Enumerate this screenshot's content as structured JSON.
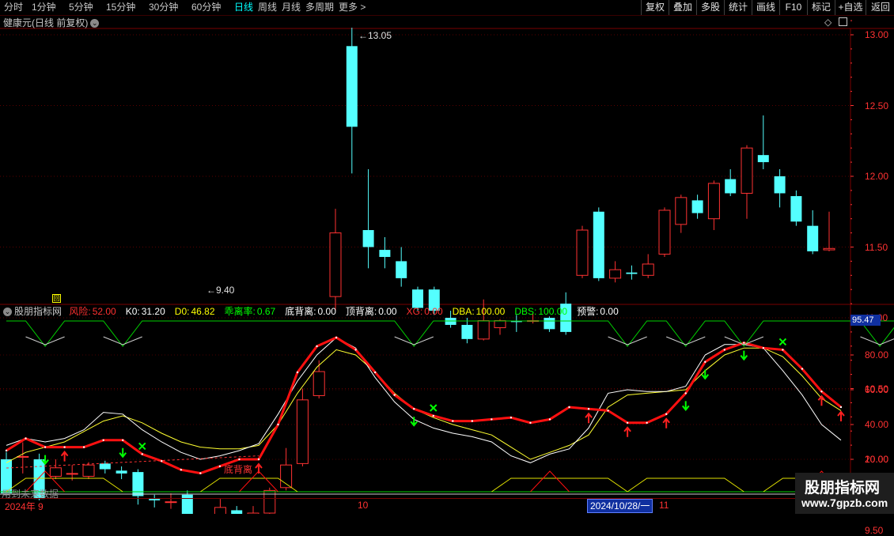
{
  "toolbar": {
    "periods": [
      "分时",
      "1分钟",
      "5分钟",
      "15分钟",
      "30分钟",
      "60分钟",
      "日线",
      "周线",
      "月线",
      "多周期",
      "更多 >"
    ],
    "active_period": "日线",
    "right_buttons": [
      "复权",
      "叠加",
      "多股",
      "统计",
      "画线",
      "F10",
      "标记",
      "+自选",
      "返回"
    ]
  },
  "main_chart": {
    "title": "健康元(日线 前复权)",
    "title_icon": "chevron-down-icon",
    "corner_icons": [
      "diamond-icon",
      "close-square-icon"
    ],
    "price_axis": [
      "13.00",
      "12.50",
      "12.00",
      "11.50",
      "11.00",
      "10.50",
      "10.00",
      "9.50"
    ],
    "high_label": "13.05",
    "low_label": "9.40",
    "candles": [
      {
        "o": 10.0,
        "c": 9.76,
        "h": 10.05,
        "l": 9.74
      },
      {
        "o": 10.02,
        "c": 10.02,
        "h": 10.12,
        "l": 9.9
      },
      {
        "o": 10.0,
        "c": 9.72,
        "h": 10.04,
        "l": 9.71
      },
      {
        "o": 9.88,
        "c": 9.94,
        "h": 10.0,
        "l": 9.86
      },
      {
        "o": 9.9,
        "c": 9.9,
        "h": 9.96,
        "l": 9.85
      },
      {
        "o": 9.88,
        "c": 9.96,
        "h": 9.98,
        "l": 9.86
      },
      {
        "o": 9.97,
        "c": 9.93,
        "h": 9.99,
        "l": 9.9
      },
      {
        "o": 9.92,
        "c": 9.9,
        "h": 9.95,
        "l": 9.86
      },
      {
        "o": 9.91,
        "c": 9.74,
        "h": 9.93,
        "l": 9.68
      },
      {
        "o": 9.72,
        "c": 9.71,
        "h": 9.75,
        "l": 9.66
      },
      {
        "o": 9.7,
        "c": 9.7,
        "h": 9.76,
        "l": 9.65
      },
      {
        "o": 9.75,
        "c": 9.6,
        "h": 9.78,
        "l": 9.57
      },
      {
        "o": 9.52,
        "c": 9.57,
        "h": 9.6,
        "l": 9.4
      },
      {
        "o": 9.58,
        "c": 9.66,
        "h": 9.72,
        "l": 9.52
      },
      {
        "o": 9.64,
        "c": 9.6,
        "h": 9.67,
        "l": 9.56
      },
      {
        "o": 9.58,
        "c": 9.62,
        "h": 9.67,
        "l": 9.55
      },
      {
        "o": 9.62,
        "c": 9.78,
        "h": 9.8,
        "l": 9.6
      },
      {
        "o": 9.8,
        "c": 9.96,
        "h": 10.08,
        "l": 9.78
      },
      {
        "o": 9.97,
        "c": 10.42,
        "h": 10.5,
        "l": 9.95
      },
      {
        "o": 10.45,
        "c": 10.62,
        "h": 10.7,
        "l": 10.43
      },
      {
        "o": 11.15,
        "c": 11.6,
        "h": 11.77,
        "l": 11.05
      },
      {
        "o": 12.92,
        "c": 12.35,
        "h": 13.05,
        "l": 12.02
      },
      {
        "o": 11.62,
        "c": 11.5,
        "h": 12.05,
        "l": 11.35
      },
      {
        "o": 11.48,
        "c": 11.43,
        "h": 11.57,
        "l": 11.35
      },
      {
        "o": 11.4,
        "c": 11.28,
        "h": 11.5,
        "l": 11.22
      },
      {
        "o": 11.2,
        "c": 11.07,
        "h": 11.22,
        "l": 11.05
      },
      {
        "o": 11.2,
        "c": 11.05,
        "h": 11.22,
        "l": 11.02
      },
      {
        "o": 11.0,
        "c": 10.95,
        "h": 11.05,
        "l": 10.93
      },
      {
        "o": 10.95,
        "c": 10.85,
        "h": 11.0,
        "l": 10.82
      },
      {
        "o": 10.85,
        "c": 10.98,
        "h": 11.13,
        "l": 10.84
      },
      {
        "o": 10.93,
        "c": 10.98,
        "h": 10.99,
        "l": 10.88
      },
      {
        "o": 10.98,
        "c": 10.97,
        "h": 11.02,
        "l": 10.9
      },
      {
        "o": 10.98,
        "c": 10.98,
        "h": 11.03,
        "l": 10.96
      },
      {
        "o": 11.0,
        "c": 10.92,
        "h": 11.01,
        "l": 10.9
      },
      {
        "o": 11.1,
        "c": 10.9,
        "h": 11.18,
        "l": 10.88
      },
      {
        "o": 11.3,
        "c": 11.62,
        "h": 11.65,
        "l": 11.28
      },
      {
        "o": 11.75,
        "c": 11.28,
        "h": 11.78,
        "l": 11.26
      },
      {
        "o": 11.28,
        "c": 11.34,
        "h": 11.4,
        "l": 11.25
      },
      {
        "o": 11.32,
        "c": 11.31,
        "h": 11.37,
        "l": 11.27
      },
      {
        "o": 11.3,
        "c": 11.38,
        "h": 11.45,
        "l": 11.28
      },
      {
        "o": 11.45,
        "c": 11.76,
        "h": 11.78,
        "l": 11.43
      },
      {
        "o": 11.66,
        "c": 11.85,
        "h": 11.87,
        "l": 11.6
      },
      {
        "o": 11.83,
        "c": 11.74,
        "h": 11.87,
        "l": 11.7
      },
      {
        "o": 11.7,
        "c": 11.95,
        "h": 11.97,
        "l": 11.62
      },
      {
        "o": 11.98,
        "c": 11.88,
        "h": 12.05,
        "l": 11.86
      },
      {
        "o": 11.88,
        "c": 12.2,
        "h": 12.22,
        "l": 11.7
      },
      {
        "o": 12.15,
        "c": 12.1,
        "h": 12.43,
        "l": 12.05
      },
      {
        "o": 12.0,
        "c": 11.88,
        "h": 12.05,
        "l": 11.78
      },
      {
        "o": 11.86,
        "c": 11.68,
        "h": 11.9,
        "l": 11.65
      },
      {
        "o": 11.65,
        "c": 11.47,
        "h": 11.76,
        "l": 11.45
      },
      {
        "o": 11.48,
        "c": 11.49,
        "h": 11.75,
        "l": 11.47
      }
    ]
  },
  "indicator": {
    "title": "股朋指标网",
    "title_icon": "chevron-down-icon",
    "values": [
      {
        "label": "风险:",
        "value": "52.00",
        "color": "#ff3030"
      },
      {
        "label": "K0:",
        "value": "31.20",
        "color": "#ffffff"
      },
      {
        "label": "D0:",
        "value": "46.82",
        "color": "#ffff00"
      },
      {
        "label": "乖离率:",
        "value": "0.67",
        "color": "#00ff00"
      },
      {
        "label": "底背离:",
        "value": "0.00",
        "color": "#ffffff"
      },
      {
        "label": "顶背离:",
        "value": "0.00",
        "color": "#ffffff"
      },
      {
        "label": "XG:",
        "value": "0.00",
        "color": "#ff3030"
      },
      {
        "label": "DBA:",
        "value": "100.00",
        "color": "#ffff00"
      },
      {
        "label": "DBS:",
        "value": "100.00",
        "color": "#00ff00"
      },
      {
        "label": "预警:",
        "value": "0.00",
        "color": "#ffffff"
      }
    ],
    "axis": [
      "80.00",
      "60.00",
      "40.00",
      "20.00"
    ],
    "current_value_badge": "95.47",
    "divergence_label": "底背离",
    "future_data_label": "用到未来数据",
    "series": {
      "risk": [
        25,
        32,
        27,
        27,
        27,
        31,
        31,
        23,
        19,
        14,
        12,
        16,
        20,
        20,
        40,
        70,
        85,
        90,
        83,
        70,
        57,
        49,
        45,
        42,
        42,
        43,
        44,
        41,
        43,
        50,
        49,
        48,
        41,
        41,
        46,
        58,
        76,
        83,
        87,
        84,
        83,
        72,
        59,
        50
      ],
      "k0": [
        28,
        32,
        30,
        32,
        37,
        47,
        46,
        37,
        30,
        24,
        20,
        22,
        25,
        29,
        46,
        65,
        80,
        90,
        84,
        67,
        53,
        43,
        38,
        35,
        33,
        30,
        22,
        18,
        23,
        26,
        38,
        58,
        60,
        59,
        59,
        62,
        80,
        86,
        86,
        84,
        71,
        57,
        40,
        31
      ],
      "d0": [
        18,
        24,
        27,
        30,
        36,
        42,
        45,
        41,
        35,
        30,
        27,
        26,
        26,
        28,
        40,
        58,
        73,
        83,
        80,
        70,
        58,
        49,
        44,
        40,
        37,
        34,
        27,
        20,
        24,
        28,
        34,
        50,
        57,
        58,
        59,
        60,
        71,
        80,
        84,
        84,
        79,
        68,
        55,
        48
      ]
    },
    "markers": [
      {
        "i": 2,
        "type": "green-down-arrow"
      },
      {
        "i": 3,
        "type": "red-up-arrow"
      },
      {
        "i": 6,
        "type": "green-down-arrow"
      },
      {
        "i": 7,
        "type": "green-x"
      },
      {
        "i": 13,
        "type": "red-up-arrow"
      },
      {
        "i": 21,
        "type": "green-down-arrow"
      },
      {
        "i": 22,
        "type": "green-x"
      },
      {
        "i": 30,
        "type": "red-up-arrow"
      },
      {
        "i": 32,
        "type": "red-up-arrow"
      },
      {
        "i": 34,
        "type": "red-up-arrow"
      },
      {
        "i": 35,
        "type": "green-down-arrow"
      },
      {
        "i": 36,
        "type": "green-down-arrow"
      },
      {
        "i": 38,
        "type": "green-down-arrow"
      },
      {
        "i": 40,
        "type": "green-x"
      },
      {
        "i": 42,
        "type": "red-up-arrow"
      },
      {
        "i": 43,
        "type": "red-up-arrow"
      },
      {
        "i": 49,
        "type": "green-x"
      }
    ]
  },
  "date_axis": {
    "labels": [
      "2024年 9",
      "10",
      "11"
    ],
    "cursor_date": "2024/10/28/一"
  },
  "watermark": {
    "title": "股朋指标网",
    "url": "www.7gpzb.com"
  },
  "colors": {
    "up": "#ff3232",
    "down": "#54ffff",
    "grid": "#7a0000",
    "axis_text": "#ff3232"
  }
}
